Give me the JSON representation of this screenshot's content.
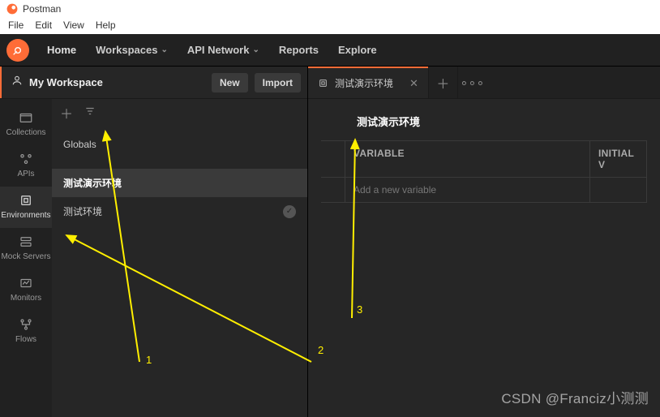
{
  "window": {
    "title": "Postman"
  },
  "menu": [
    "File",
    "Edit",
    "View",
    "Help"
  ],
  "nav": {
    "home": "Home",
    "workspaces": "Workspaces",
    "api_network": "API Network",
    "reports": "Reports",
    "explore": "Explore"
  },
  "workspace": {
    "name": "My Workspace",
    "new_btn": "New",
    "import_btn": "Import"
  },
  "sidebar": {
    "collections": "Collections",
    "apis": "APIs",
    "environments": "Environments",
    "mock_servers": "Mock Servers",
    "monitors": "Monitors",
    "flows": "Flows"
  },
  "env_list": {
    "globals": "Globals",
    "items": [
      {
        "name": "测试演示环境",
        "selected": true,
        "active": false
      },
      {
        "name": "测试环境",
        "selected": false,
        "active": true
      }
    ]
  },
  "tab": {
    "label": "测试演示环境"
  },
  "env_detail": {
    "title": "测试演示环境",
    "col_variable": "VARIABLE",
    "col_initial": "INITIAL V",
    "placeholder": "Add a new variable"
  },
  "annotations": {
    "a1": "1",
    "a2": "2",
    "a3": "3"
  },
  "watermark": "CSDN @Franciz小测测"
}
